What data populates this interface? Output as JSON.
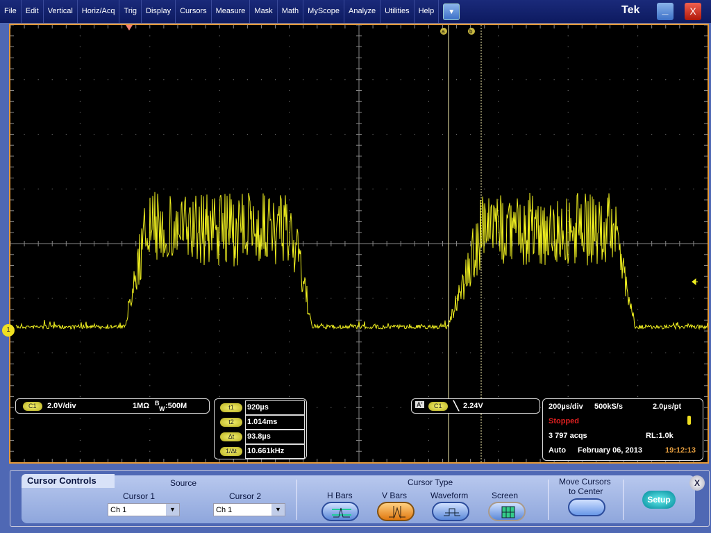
{
  "menu": [
    "File",
    "Edit",
    "Vertical",
    "Horiz/Acq",
    "Trig",
    "Display",
    "Cursors",
    "Measure",
    "Mask",
    "Math",
    "MyScope",
    "Analyze",
    "Utilities",
    "Help"
  ],
  "brand": "Tek",
  "window": {
    "minimize": "_",
    "close": "X"
  },
  "cursors": {
    "a_label": "a",
    "b_label": "b"
  },
  "channel_marker": "1",
  "channel": {
    "badge": "C1",
    "scale": "2.0V/div",
    "impedance": "1MΩ",
    "bw_prefix": "B",
    "bw_sub": "W",
    "bw": ":500M"
  },
  "readout": [
    {
      "label": "t1",
      "value": "920µs"
    },
    {
      "label": "t2",
      "value": "1.014ms"
    },
    {
      "label": "Δt",
      "value": "93.8µs"
    },
    {
      "label": "1/Δt",
      "value": "10.661kHz"
    }
  ],
  "trigger": {
    "mode_badge": "A'",
    "source": "C1",
    "slope": "falling",
    "level": "2.24V"
  },
  "acq": {
    "timebase": "200µs/div",
    "rate": "500kS/s",
    "per_pt": "2.0µs/pt",
    "state": "Stopped",
    "acqs": "3 797 acqs",
    "rl": "RL:1.0k",
    "mode": "Auto",
    "date": "February 06, 2013",
    "time": "19:12:13"
  },
  "colors": {
    "trace": "#f0f020",
    "border": "#e89a38",
    "stopped": "#e02020",
    "time": "#e8a040"
  },
  "panel": {
    "title": "Cursor Controls",
    "source": "Source",
    "cursor1": "Cursor 1",
    "cursor2": "Cursor 2",
    "cursor1_value": "Ch 1",
    "cursor2_value": "Ch 1",
    "cursor_type": "Cursor Type",
    "types": [
      "H Bars",
      "V Bars",
      "Waveform",
      "Screen"
    ],
    "selected_type": "V Bars",
    "move": "Move Cursors",
    "move2": "to Center",
    "setup": "Setup",
    "close": "X"
  }
}
